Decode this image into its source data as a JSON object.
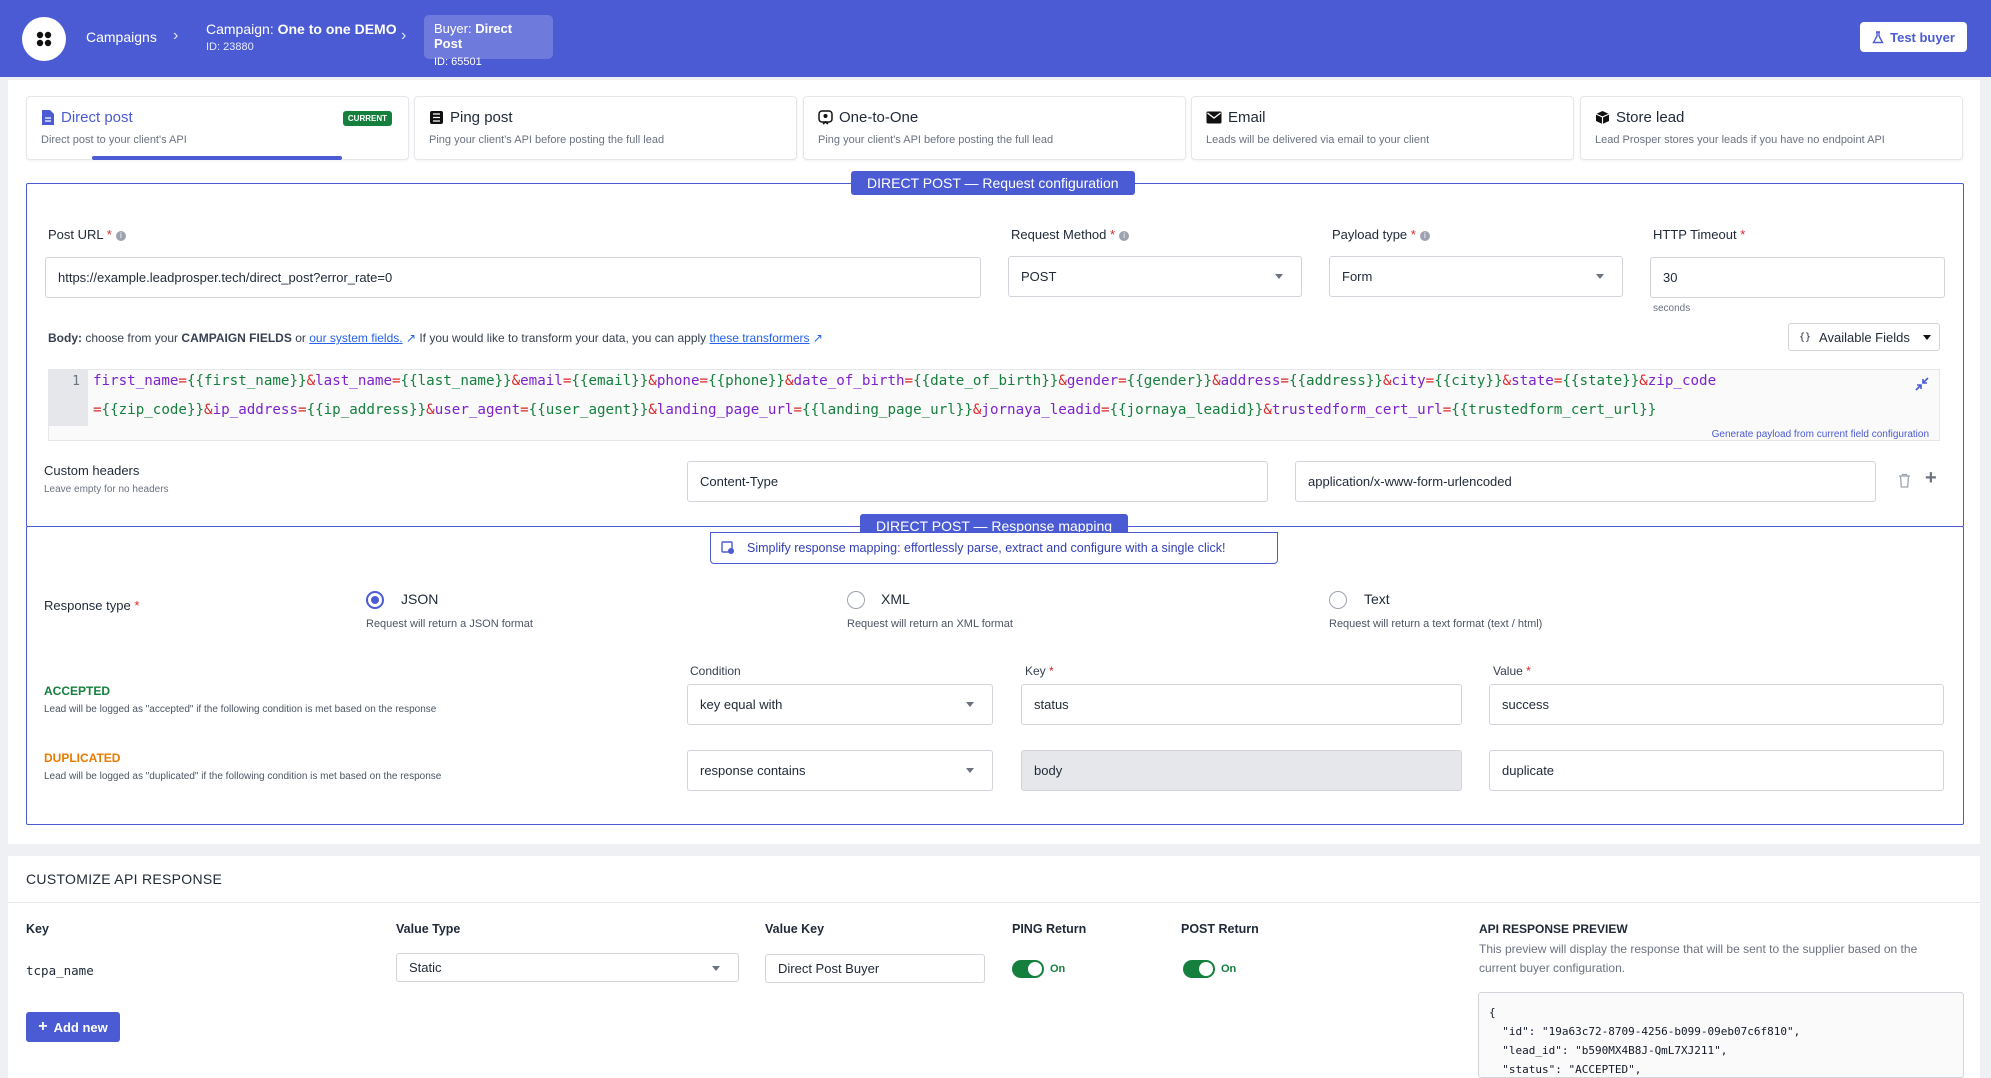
{
  "header": {
    "campaigns_label": "Campaigns",
    "campaign_prefix": "Campaign:",
    "campaign_name": "One to one DEMO",
    "campaign_id": "ID: 23880",
    "buyer_prefix": "Buyer:",
    "buyer_name": "Direct Post",
    "buyer_id": "ID: 65501",
    "test_buyer": "Test buyer"
  },
  "tabs": [
    {
      "title": "Direct post",
      "desc": "Direct post to your client's API",
      "badge": "CURRENT"
    },
    {
      "title": "Ping post",
      "desc": "Ping your client's API before posting the full lead"
    },
    {
      "title": "One-to-One",
      "desc": "Ping your client's API before posting the full lead"
    },
    {
      "title": "Email",
      "desc": "Leads will be delivered via email to your client"
    },
    {
      "title": "Store lead",
      "desc": "Lead Prosper stores your leads if you have no endpoint API"
    }
  ],
  "request": {
    "section_title": "DIRECT POST — Request configuration",
    "post_url_label": "Post URL",
    "post_url": "https://example.leadprosper.tech/direct_post?error_rate=0",
    "method_label": "Request Method",
    "method": "POST",
    "payload_label": "Payload type",
    "payload": "Form",
    "timeout_label": "HTTP Timeout",
    "timeout": "30",
    "timeout_unit": "seconds",
    "body_label": "Body:",
    "body_text1": "choose from your",
    "body_campaign_fields": "CAMPAIGN FIELDS",
    "body_or": "or",
    "body_system_fields": "our system fields.",
    "body_text2": "If you would like to transform your data, you can apply",
    "body_transformers": "these transformers",
    "available_fields": "Available Fields",
    "line_number": "1",
    "generate_link": "Generate payload from current field configuration",
    "custom_headers_label": "Custom headers",
    "custom_headers_hint": "Leave empty for no headers",
    "header_name": "Content-Type",
    "header_value": "application/x-www-form-urlencoded"
  },
  "code_line1": [
    [
      "k",
      "first_name"
    ],
    [
      "e",
      "="
    ],
    [
      "v",
      "{{first_name}}"
    ],
    [
      "a",
      "&"
    ],
    [
      "k",
      "last_name"
    ],
    [
      "e",
      "="
    ],
    [
      "v",
      "{{last_name}}"
    ],
    [
      "a",
      "&"
    ],
    [
      "k",
      "email"
    ],
    [
      "e",
      "="
    ],
    [
      "v",
      "{{email}}"
    ],
    [
      "a",
      "&"
    ],
    [
      "k",
      "phone"
    ],
    [
      "e",
      "="
    ],
    [
      "v",
      "{{phone}}"
    ],
    [
      "a",
      "&"
    ],
    [
      "k",
      "date_of_birth"
    ],
    [
      "e",
      "="
    ],
    [
      "v",
      "{{date_of_birth}}"
    ],
    [
      "a",
      "&"
    ],
    [
      "k",
      "gender"
    ],
    [
      "e",
      "="
    ],
    [
      "v",
      "{{gender}}"
    ],
    [
      "a",
      "&"
    ],
    [
      "k",
      "address"
    ],
    [
      "e",
      "="
    ],
    [
      "v",
      "{{address}}"
    ],
    [
      "a",
      "&"
    ],
    [
      "k",
      "city"
    ],
    [
      "e",
      "="
    ],
    [
      "v",
      "{{city}}"
    ],
    [
      "a",
      "&"
    ],
    [
      "k",
      "state"
    ],
    [
      "e",
      "="
    ],
    [
      "v",
      "{{state}}"
    ],
    [
      "a",
      "&"
    ],
    [
      "k",
      "zip_code"
    ]
  ],
  "code_line2": [
    [
      "e",
      "="
    ],
    [
      "v",
      "{{zip_code}}"
    ],
    [
      "a",
      "&"
    ],
    [
      "k",
      "ip_address"
    ],
    [
      "e",
      "="
    ],
    [
      "v",
      "{{ip_address}}"
    ],
    [
      "a",
      "&"
    ],
    [
      "k",
      "user_agent"
    ],
    [
      "e",
      "="
    ],
    [
      "v",
      "{{user_agent}}"
    ],
    [
      "a",
      "&"
    ],
    [
      "k",
      "landing_page_url"
    ],
    [
      "e",
      "="
    ],
    [
      "v",
      "{{landing_page_url}}"
    ],
    [
      "a",
      "&"
    ],
    [
      "k",
      "jornaya_leadid"
    ],
    [
      "e",
      "="
    ],
    [
      "v",
      "{{jornaya_leadid}}"
    ],
    [
      "a",
      "&"
    ],
    [
      "k",
      "trustedform_cert_url"
    ],
    [
      "e",
      "="
    ],
    [
      "v",
      "{{trustedform_cert_url}}"
    ]
  ],
  "response": {
    "section_title": "DIRECT POST — Response mapping",
    "simplify_text": "Simplify response mapping: effortlessly parse, extract and configure with a single click!",
    "type_label": "Response type",
    "json": "JSON",
    "json_desc": "Request will return a JSON format",
    "xml": "XML",
    "xml_desc": "Request will return an XML format",
    "text": "Text",
    "text_desc": "Request will return a text format (text / html)",
    "condition_label": "Condition",
    "key_label": "Key",
    "value_label": "Value",
    "accepted": "ACCEPTED",
    "accepted_desc": "Lead will be logged as \"accepted\" if the following condition is met based on the response",
    "accepted_condition": "key equal with",
    "accepted_key": "status",
    "accepted_value": "success",
    "duplicated": "DUPLICATED",
    "duplicated_desc": "Lead will be logged as \"duplicated\" if the following condition is met based on the response",
    "duplicated_condition": "response contains",
    "duplicated_key": "body",
    "duplicated_value": "duplicate"
  },
  "customize": {
    "title": "CUSTOMIZE API RESPONSE",
    "col_key": "Key",
    "col_value_type": "Value Type",
    "col_value_key": "Value Key",
    "col_ping": "PING Return",
    "col_post": "POST Return",
    "row_key": "tcpa_name",
    "row_value_type": "Static",
    "row_value_key": "Direct Post Buyer",
    "ping_state": "On",
    "post_state": "On",
    "add_new": "Add new",
    "preview_title": "API RESPONSE PREVIEW",
    "preview_desc1": "This preview will display the response that will be sent to the supplier based on the",
    "preview_desc2": "current buyer configuration.",
    "preview_json": "{\n  \"id\": \"19a63c72-8709-4256-b099-09eb07c6f810\",\n  \"lead_id\": \"b590MX4B8J-QmL7XJ211\",\n  \"status\": \"ACCEPTED\","
  },
  "colors": {
    "accent": "#4b5bd4",
    "success": "#15803d",
    "warning": "#ea7a00",
    "danger": "#dc2626"
  }
}
